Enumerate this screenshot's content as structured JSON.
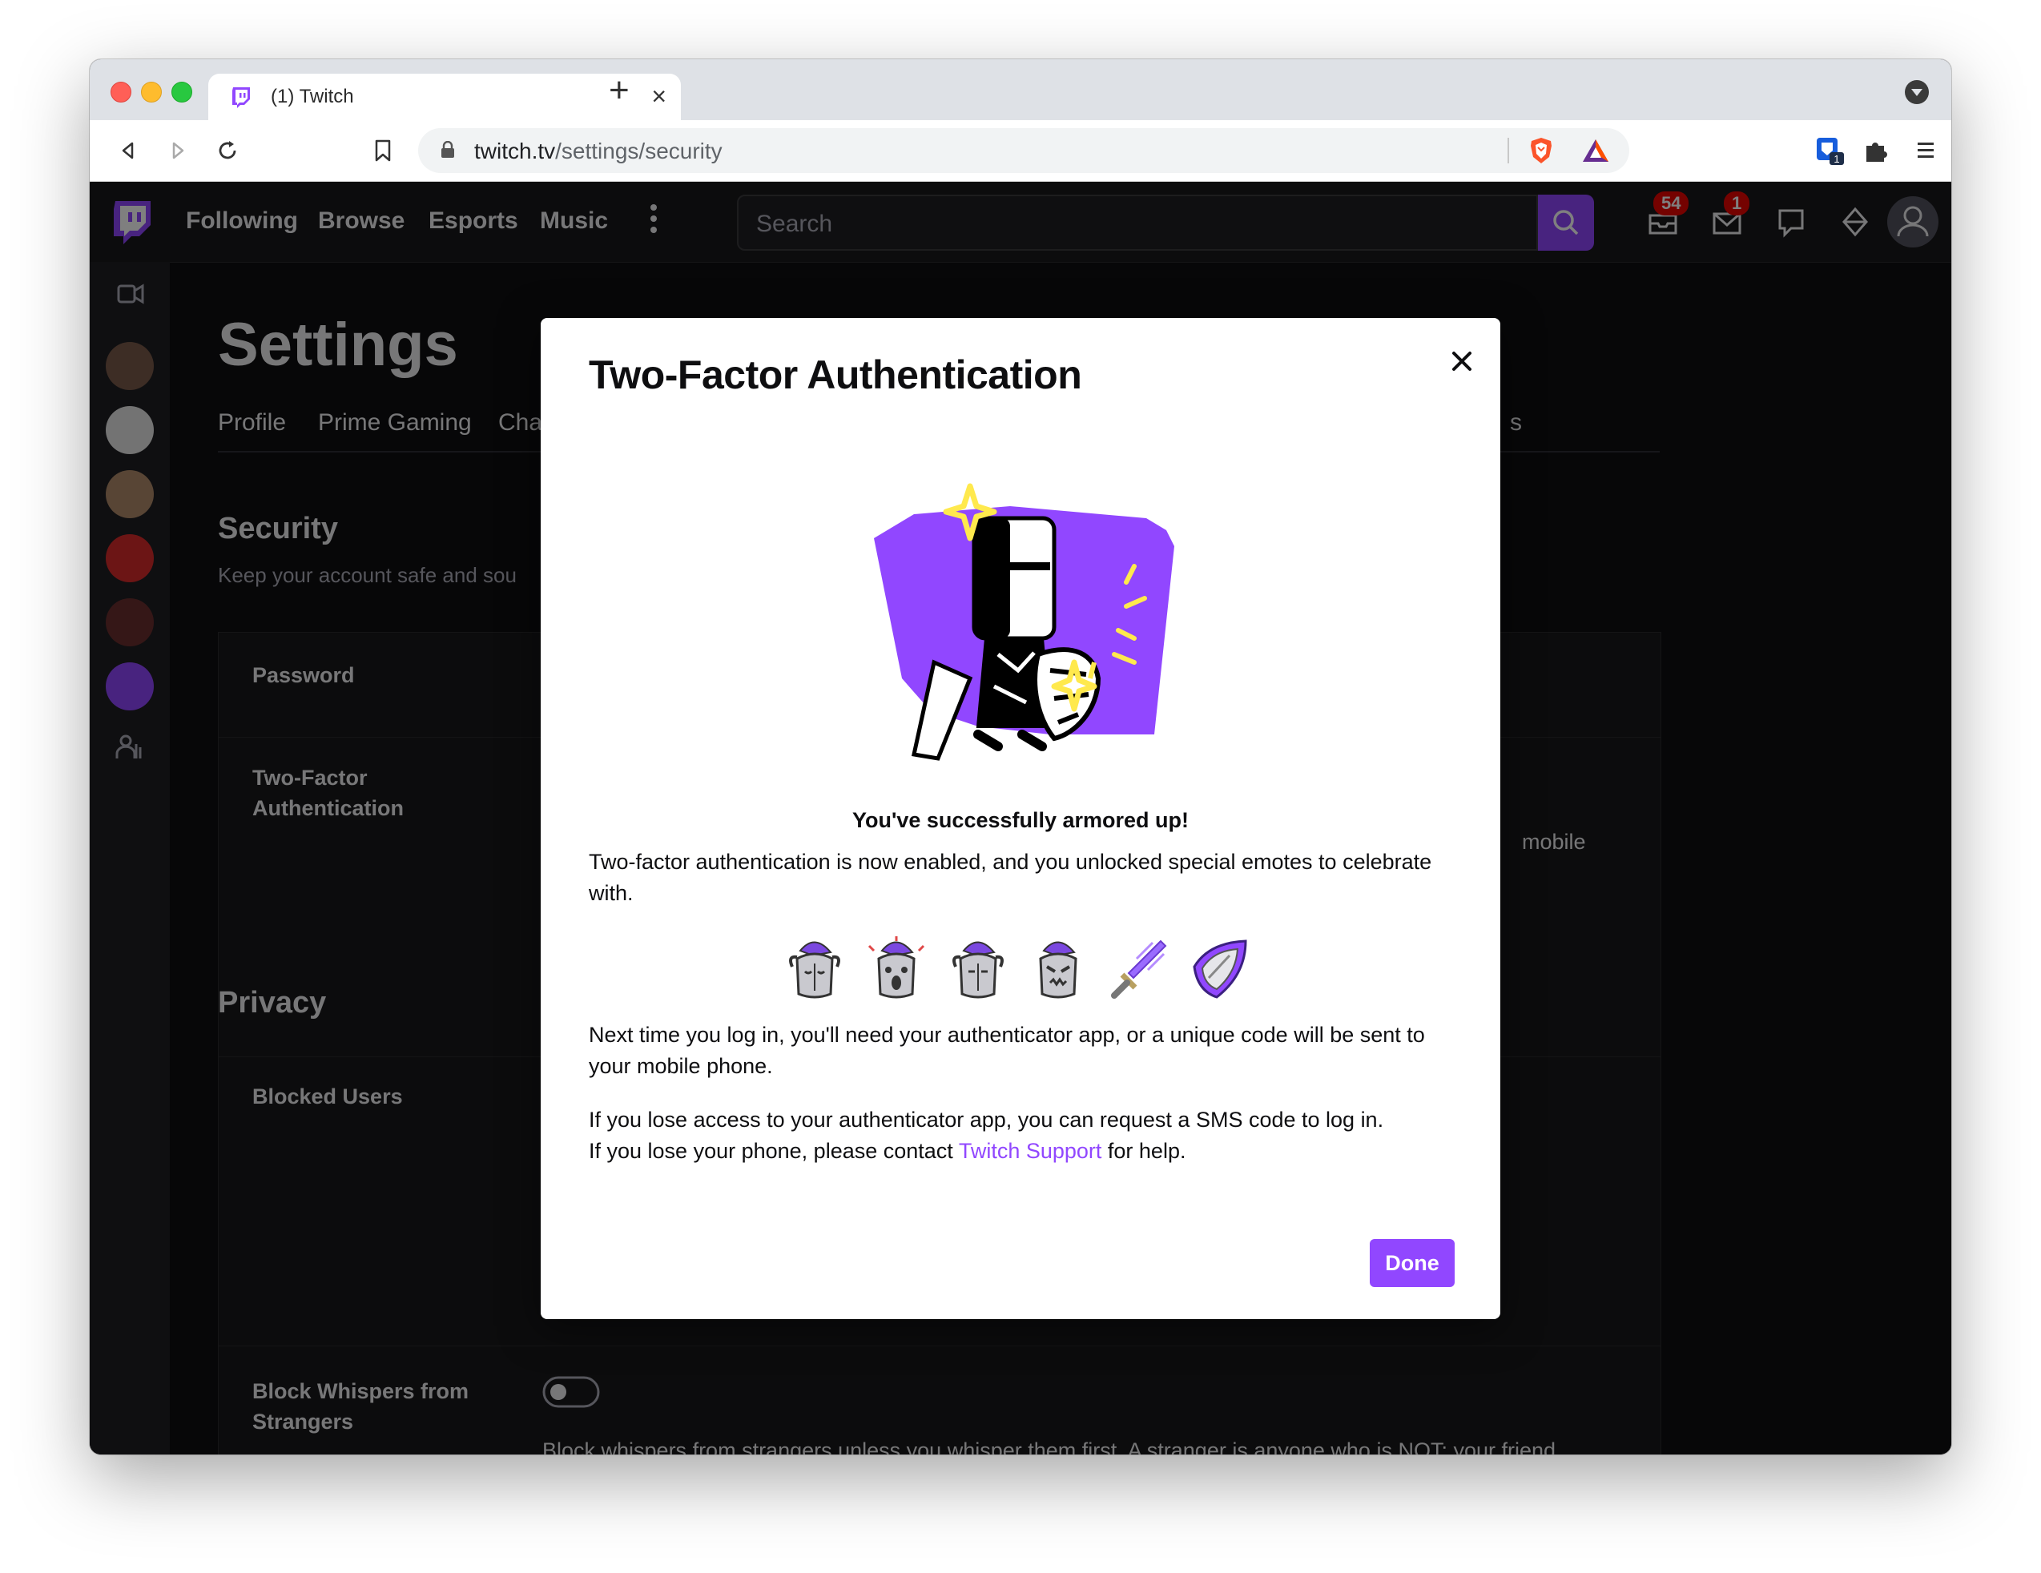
{
  "browser": {
    "tab_title": "(1) Twitch",
    "url_host": "twitch.tv",
    "url_path": "/settings/security",
    "extension_badge": "1"
  },
  "twitch": {
    "nav": [
      "Following",
      "Browse",
      "Esports",
      "Music"
    ],
    "search_placeholder": "Search",
    "badges": {
      "notifications": "54",
      "inbox": "1"
    },
    "settings_title": "Settings",
    "settings_tabs": [
      "Profile",
      "Prime Gaming",
      "Cha",
      "s"
    ],
    "security": {
      "heading": "Security",
      "subheading": "Keep your account safe and sou",
      "password_label": "Password",
      "twofa_label": "Two-Factor Authentication",
      "twofa_trailing": "mobile"
    },
    "privacy": {
      "heading": "Privacy",
      "blocked_users_label": "Blocked Users",
      "block_whispers_label": "Block Whispers from Strangers",
      "block_whispers_desc": "Block whispers from strangers unless you whisper them first. A stranger is anyone who is NOT: your friend,"
    }
  },
  "modal": {
    "title": "Two-Factor Authentication",
    "headline": "You've successfully armored up!",
    "para1": "Two-factor authentication is now enabled, and you unlocked special emotes to celebrate with.",
    "para2": "Next time you log in, you'll need your authenticator app, or a unique code will be sent to your mobile phone.",
    "para3_line1": "If you lose access to your authenticator app, you can request a SMS code to log in.",
    "para3_line2_prefix": "If you lose your phone, please contact ",
    "para3_link": "Twitch Support",
    "para3_line2_suffix": " for help.",
    "done_label": "Done",
    "accent": "#9147ff"
  }
}
